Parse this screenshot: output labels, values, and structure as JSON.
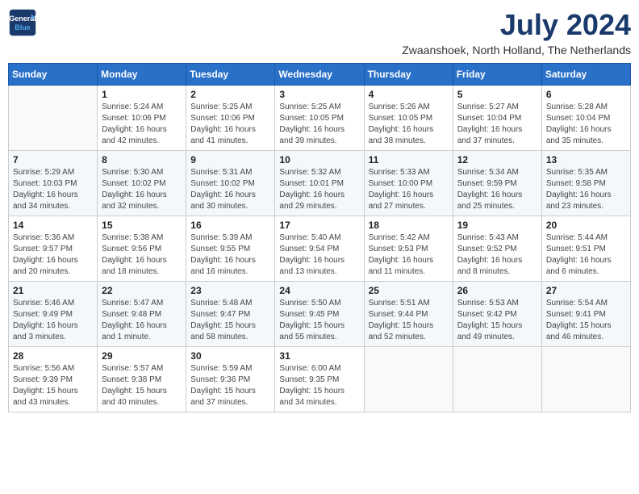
{
  "header": {
    "logo_line1": "General",
    "logo_line2": "Blue",
    "month_title": "July 2024",
    "location": "Zwaanshoek, North Holland, The Netherlands"
  },
  "weekdays": [
    "Sunday",
    "Monday",
    "Tuesday",
    "Wednesday",
    "Thursday",
    "Friday",
    "Saturday"
  ],
  "weeks": [
    [
      {
        "day": "",
        "info": ""
      },
      {
        "day": "1",
        "info": "Sunrise: 5:24 AM\nSunset: 10:06 PM\nDaylight: 16 hours\nand 42 minutes."
      },
      {
        "day": "2",
        "info": "Sunrise: 5:25 AM\nSunset: 10:06 PM\nDaylight: 16 hours\nand 41 minutes."
      },
      {
        "day": "3",
        "info": "Sunrise: 5:25 AM\nSunset: 10:05 PM\nDaylight: 16 hours\nand 39 minutes."
      },
      {
        "day": "4",
        "info": "Sunrise: 5:26 AM\nSunset: 10:05 PM\nDaylight: 16 hours\nand 38 minutes."
      },
      {
        "day": "5",
        "info": "Sunrise: 5:27 AM\nSunset: 10:04 PM\nDaylight: 16 hours\nand 37 minutes."
      },
      {
        "day": "6",
        "info": "Sunrise: 5:28 AM\nSunset: 10:04 PM\nDaylight: 16 hours\nand 35 minutes."
      }
    ],
    [
      {
        "day": "7",
        "info": "Sunrise: 5:29 AM\nSunset: 10:03 PM\nDaylight: 16 hours\nand 34 minutes."
      },
      {
        "day": "8",
        "info": "Sunrise: 5:30 AM\nSunset: 10:02 PM\nDaylight: 16 hours\nand 32 minutes."
      },
      {
        "day": "9",
        "info": "Sunrise: 5:31 AM\nSunset: 10:02 PM\nDaylight: 16 hours\nand 30 minutes."
      },
      {
        "day": "10",
        "info": "Sunrise: 5:32 AM\nSunset: 10:01 PM\nDaylight: 16 hours\nand 29 minutes."
      },
      {
        "day": "11",
        "info": "Sunrise: 5:33 AM\nSunset: 10:00 PM\nDaylight: 16 hours\nand 27 minutes."
      },
      {
        "day": "12",
        "info": "Sunrise: 5:34 AM\nSunset: 9:59 PM\nDaylight: 16 hours\nand 25 minutes."
      },
      {
        "day": "13",
        "info": "Sunrise: 5:35 AM\nSunset: 9:58 PM\nDaylight: 16 hours\nand 23 minutes."
      }
    ],
    [
      {
        "day": "14",
        "info": "Sunrise: 5:36 AM\nSunset: 9:57 PM\nDaylight: 16 hours\nand 20 minutes."
      },
      {
        "day": "15",
        "info": "Sunrise: 5:38 AM\nSunset: 9:56 PM\nDaylight: 16 hours\nand 18 minutes."
      },
      {
        "day": "16",
        "info": "Sunrise: 5:39 AM\nSunset: 9:55 PM\nDaylight: 16 hours\nand 16 minutes."
      },
      {
        "day": "17",
        "info": "Sunrise: 5:40 AM\nSunset: 9:54 PM\nDaylight: 16 hours\nand 13 minutes."
      },
      {
        "day": "18",
        "info": "Sunrise: 5:42 AM\nSunset: 9:53 PM\nDaylight: 16 hours\nand 11 minutes."
      },
      {
        "day": "19",
        "info": "Sunrise: 5:43 AM\nSunset: 9:52 PM\nDaylight: 16 hours\nand 8 minutes."
      },
      {
        "day": "20",
        "info": "Sunrise: 5:44 AM\nSunset: 9:51 PM\nDaylight: 16 hours\nand 6 minutes."
      }
    ],
    [
      {
        "day": "21",
        "info": "Sunrise: 5:46 AM\nSunset: 9:49 PM\nDaylight: 16 hours\nand 3 minutes."
      },
      {
        "day": "22",
        "info": "Sunrise: 5:47 AM\nSunset: 9:48 PM\nDaylight: 16 hours\nand 1 minute."
      },
      {
        "day": "23",
        "info": "Sunrise: 5:48 AM\nSunset: 9:47 PM\nDaylight: 15 hours\nand 58 minutes."
      },
      {
        "day": "24",
        "info": "Sunrise: 5:50 AM\nSunset: 9:45 PM\nDaylight: 15 hours\nand 55 minutes."
      },
      {
        "day": "25",
        "info": "Sunrise: 5:51 AM\nSunset: 9:44 PM\nDaylight: 15 hours\nand 52 minutes."
      },
      {
        "day": "26",
        "info": "Sunrise: 5:53 AM\nSunset: 9:42 PM\nDaylight: 15 hours\nand 49 minutes."
      },
      {
        "day": "27",
        "info": "Sunrise: 5:54 AM\nSunset: 9:41 PM\nDaylight: 15 hours\nand 46 minutes."
      }
    ],
    [
      {
        "day": "28",
        "info": "Sunrise: 5:56 AM\nSunset: 9:39 PM\nDaylight: 15 hours\nand 43 minutes."
      },
      {
        "day": "29",
        "info": "Sunrise: 5:57 AM\nSunset: 9:38 PM\nDaylight: 15 hours\nand 40 minutes."
      },
      {
        "day": "30",
        "info": "Sunrise: 5:59 AM\nSunset: 9:36 PM\nDaylight: 15 hours\nand 37 minutes."
      },
      {
        "day": "31",
        "info": "Sunrise: 6:00 AM\nSunset: 9:35 PM\nDaylight: 15 hours\nand 34 minutes."
      },
      {
        "day": "",
        "info": ""
      },
      {
        "day": "",
        "info": ""
      },
      {
        "day": "",
        "info": ""
      }
    ]
  ]
}
